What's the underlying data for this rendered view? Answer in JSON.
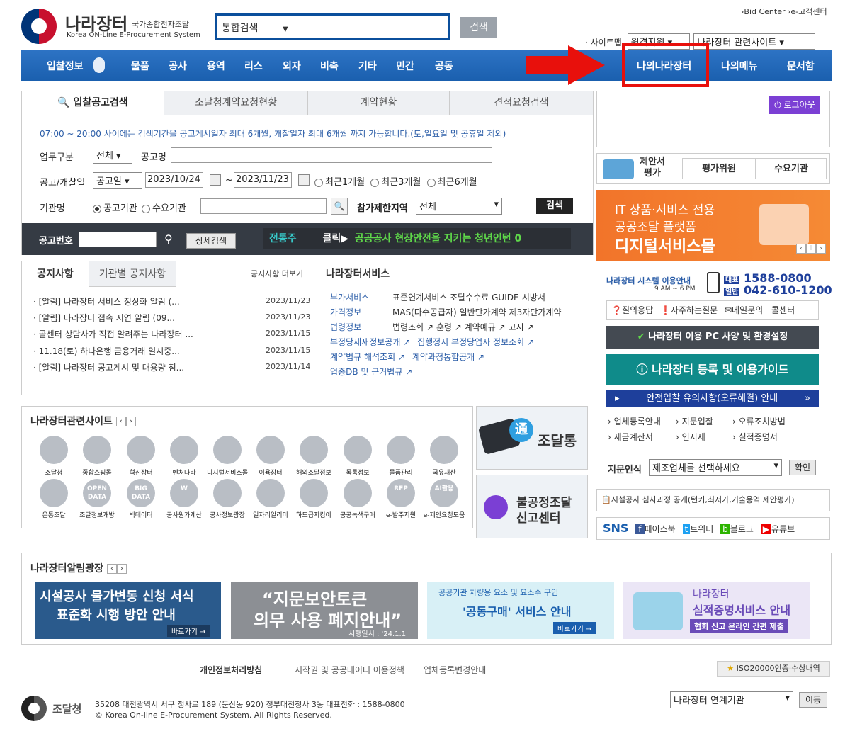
{
  "header": {
    "logo_main": "나라장터",
    "logo_sub": "국가종합전자조달",
    "logo_en": "Korea ON-Line E-Procurement System",
    "search_select": "통합검색",
    "search_button": "검색",
    "top_links": "›Bid Center  ›e-고객센터",
    "sitemap_label": "· 사이트맵",
    "remote_support": "원격지원",
    "related_site_select": "나라장터 관련사이트"
  },
  "nav": {
    "left": [
      "입찰정보",
      "물품",
      "공사",
      "용역",
      "리스",
      "외자",
      "비축",
      "기타",
      "민간",
      "공동"
    ],
    "right": [
      "나의나라장터",
      "나의메뉴",
      "문서함"
    ]
  },
  "search_panel": {
    "tabs": [
      "입찰공고검색",
      "조달청계약요청현황",
      "계약현황",
      "견적요청검색"
    ],
    "notice": "07:00 ~ 20:00 사이에는 검색기간을 공고게시일자 최대 6개월, 개찰일자 최대 6개월 까지 가능합니다.(토,일요일 및 공휴일 제외)",
    "work_type_label": "업무구분",
    "work_type_value": "전체",
    "notice_name_label": "공고명",
    "date_label": "공고/개찰일",
    "date_type": "공고일",
    "date_from": "2023/10/24",
    "date_tilde": "~",
    "date_to": "2023/11/23",
    "period_options": [
      "최근1개월",
      "최근3개월",
      "최근6개월"
    ],
    "agency_label": "기관명",
    "agency_options": [
      "공고기관",
      "수요기관"
    ],
    "region_label": "참가제한지역",
    "region_value": "전체",
    "search_button": "검색",
    "notice_no_label": "공고번호",
    "detail_button": "상세검색",
    "ticker_tag": "전통주",
    "ticker_click": "클릭▶",
    "ticker_text": "공공공사 현장안전을 지키는 청년인턴 0"
  },
  "notices": {
    "tabs": [
      "공지사항",
      "기관별 공지사항"
    ],
    "more": "공지사항 더보기",
    "items": [
      {
        "title": "· [알림] 나라장터 서비스 정상화 알림 (...",
        "date": "2023/11/23"
      },
      {
        "title": "· [알림] 나라장터 접속 지연 알림 (09...",
        "date": "2023/11/23"
      },
      {
        "title": "· 콜센터 상담사가 직접 알려주는 나라장터 ...",
        "date": "2023/11/15"
      },
      {
        "title": "· 11.18(토) 하나은행 금융거래 일시중...",
        "date": "2023/11/15"
      },
      {
        "title": "· [알림] 나라장터 공고게시 및 대용량 첨...",
        "date": "2023/11/14"
      }
    ]
  },
  "services": {
    "title": "나라장터서비스",
    "rows": [
      {
        "key": "부가서비스",
        "value": "표준연계서비스  조달수수료  GUIDE-시방서"
      },
      {
        "key": "가격정보",
        "value": "MAS(다수공급자)  일반단가계약  제3자단가계약"
      },
      {
        "key": "법령정보",
        "value": "법령조회 ↗  훈령 ↗  계약예규 ↗  고시 ↗"
      }
    ],
    "links": [
      "부정당제재정보공개",
      "집행정지 부정당업자 정보조회",
      "계약법규 해석조회",
      "계약과정통합공개",
      "업종DB 및 근거법규"
    ]
  },
  "right": {
    "logout": "로그아웃",
    "proposal": "제안서\n평가",
    "evaluator": "평가위원",
    "demand_agency": "수요기관",
    "banner_line1": "IT 상품·서비스 전용",
    "banner_line2": "공공조달 플랫폼",
    "banner_line3": "디지털서비스몰",
    "guide_label": "나라장터 시스템 이용안내",
    "guide_hours": "9 AM ~ 6 PM",
    "tel_main_tag": "대표",
    "tel_main": "1588-0800",
    "tel_general_tag": "일반",
    "tel_general": "042-610-1200",
    "help_items": [
      "질의응답",
      "자주하는질문",
      "메일문의",
      "콜센터"
    ],
    "pc_env": "나라장터 이용 PC 사양 및 환경설정",
    "reg_guide": "나라장터 등록 및 이용가이드",
    "safety": "안전입찰 유의사항(오류해결) 안내",
    "quick_links": [
      "업체등록안내",
      "지문입찰",
      "오류조치방법",
      "세금계산서",
      "인지세",
      "실적증명서"
    ],
    "fingerprint_label": "지문인식",
    "fingerprint_select": "제조업체를 선택하세요",
    "confirm": "확인",
    "facility": "시설공사 심사과정 공개(턴키,최저가,기술용역 제안평가)",
    "sns_label": "SNS",
    "sns": [
      "페이스북",
      "트위터",
      "블로그",
      "유튜브"
    ]
  },
  "related": {
    "title": "나라장터관련사이트",
    "row1": [
      "조달청",
      "종합쇼핑몰",
      "혁신장터",
      "벤처나라",
      "디지털서비스몰",
      "이용장터",
      "해외조달정보",
      "목록정보",
      "물품관리",
      "국유재산"
    ],
    "row2": [
      "온통조달",
      "조달정보개방",
      "빅데이터",
      "공사원가계산",
      "공사정보광장",
      "일자리알리미",
      "하도급지킴이",
      "공공녹색구매",
      "e-발주지원",
      "e-제안요청도움"
    ],
    "icon_text": {
      "open": "OPEN\nDATA",
      "big": "BIG\nDATA",
      "w": "W",
      "rfp": "RFP",
      "ai": "AI활용"
    },
    "jodaltong": "조달통",
    "jodaltong_char": "通",
    "unfair_line1": "불공정조달",
    "unfair_line2": "신고센터"
  },
  "plaza": {
    "title": "나라장터알림광장",
    "banners": [
      {
        "line1": "시설공사 물가변동 신청 서식",
        "line2": "표준화 시행 방안 안내",
        "btn": "바로가기 →"
      },
      {
        "line1": "“지문보안토큰",
        "line2": "의무 사용 폐지안내”",
        "sub": "시행일시 : '24.1.1"
      },
      {
        "line1": "공공기관 차량용 요소 및 요소수 구입",
        "line2": "'공동구매' 서비스 안내",
        "btn": "바로가기 →"
      },
      {
        "line1": "나라장터",
        "line2": "실적증명서비스 안내",
        "sub": "협회 신고 온라인 간편 제출"
      }
    ]
  },
  "footer": {
    "links": [
      "개인정보처리방침",
      "저작권 및 공공데이터 이용정책",
      "업체등록변경안내"
    ],
    "iso": "ISO20000인증·수상내역",
    "org": "조달청",
    "address": "35208 대전광역시 서구 청사로 189 (둔산동 920) 정부대전청사 3동 대표전화 : 1588-0800",
    "copyright": "© Korea On-line E-Procurement System. All Rights Reserved.",
    "linked_select": "나라장터 연계기관",
    "move": "이동"
  },
  "colors": {
    "nav": "#1a5fae",
    "accent_red": "#e8100c",
    "teal": "#0f8b8a",
    "orange": "#f2742a",
    "purple": "#7b3fd4"
  }
}
